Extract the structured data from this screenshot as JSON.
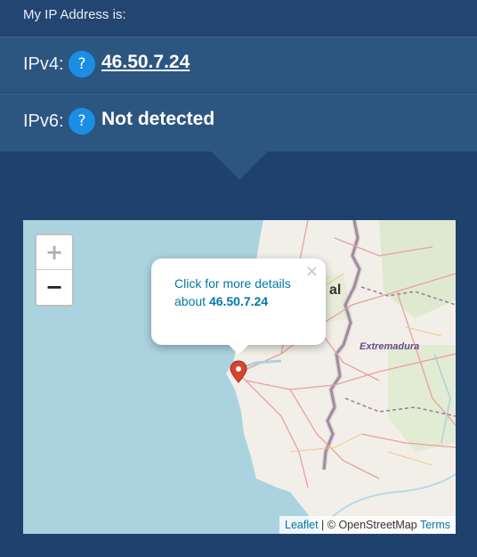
{
  "header": {
    "intro": "My IP Address is:"
  },
  "ipv4": {
    "label": "IPv4:",
    "help": "?",
    "value": "46.50.7.24"
  },
  "ipv6": {
    "label": "IPv6:",
    "help": "?",
    "value": "Not detected"
  },
  "map": {
    "zoom_in": "+",
    "zoom_out": "−",
    "popup": {
      "close": "×",
      "text_prefix": "Click for more details about",
      "ip": "46.50.7.24"
    },
    "labels": {
      "region": "Extremadura",
      "partial": "al"
    },
    "attribution": {
      "leaflet": "Leaflet",
      "separator": "|",
      "osm": "© OpenStreetMap",
      "terms": "Terms"
    }
  },
  "colors": {
    "page_bg": "#1f416d",
    "row_bg": "#2c5580",
    "accent": "#1a8ee3",
    "link": "#0078a8",
    "marker": "#d9442c"
  }
}
